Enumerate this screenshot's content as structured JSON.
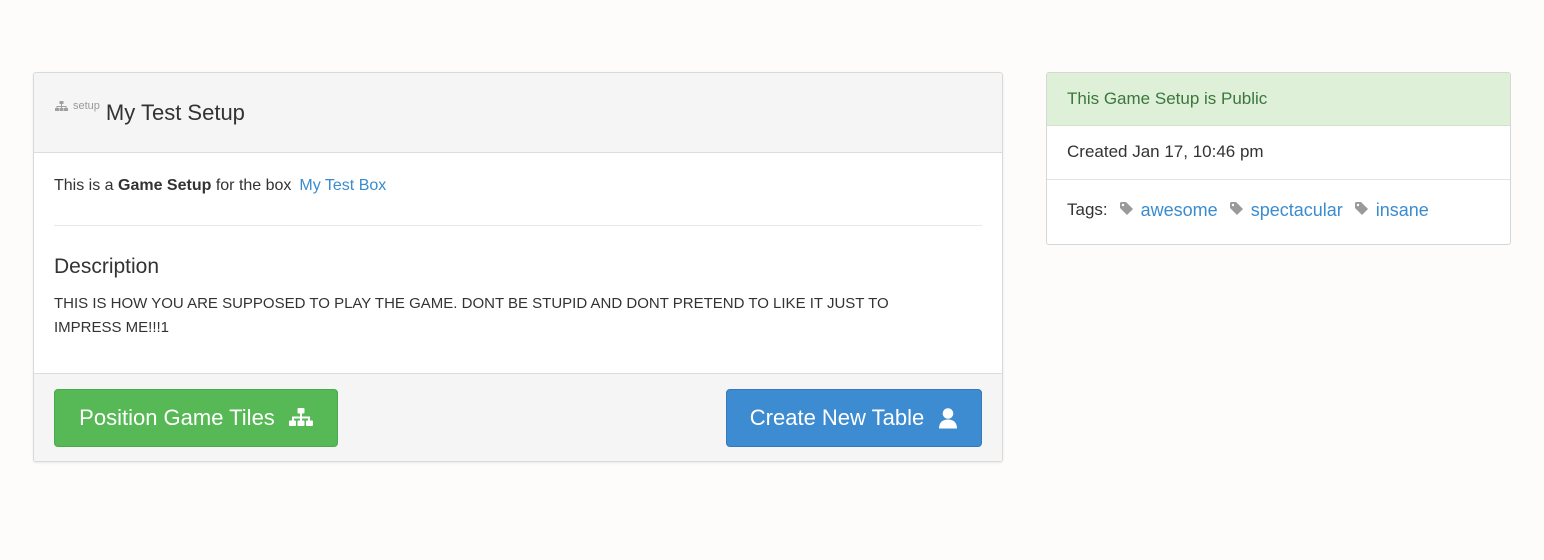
{
  "setup": {
    "kicker": "setup",
    "title": "My Test Setup",
    "intro_prefix": "This is a ",
    "intro_strong": "Game Setup",
    "intro_suffix": " for the box",
    "box_link": "My Test Box",
    "description_title": "Description",
    "description_text": "THIS IS HOW YOU ARE SUPPOSED TO PLAY THE GAME. DONT BE STUPID AND DONT PRETEND TO LIKE IT JUST TO IMPRESS ME!!!1",
    "position_button": "Position Game Tiles",
    "create_button": "Create New Table"
  },
  "sidebar": {
    "status": "This Game Setup is Public",
    "created": "Created Jan 17, 10:46 pm",
    "tags_label": "Tags:",
    "tags": [
      "awesome",
      "spectacular",
      "insane"
    ]
  },
  "icons": {
    "kicker_icon": "sitemap-icon",
    "position_icon": "sitemap-icon",
    "create_icon": "user-icon",
    "tag_icon": "tag-icon"
  },
  "colors": {
    "green_button": "#56b955",
    "blue_button": "#3d8bd0",
    "link": "#3a8ccf",
    "status_bg": "#dff0d8",
    "status_text": "#3c763d"
  }
}
